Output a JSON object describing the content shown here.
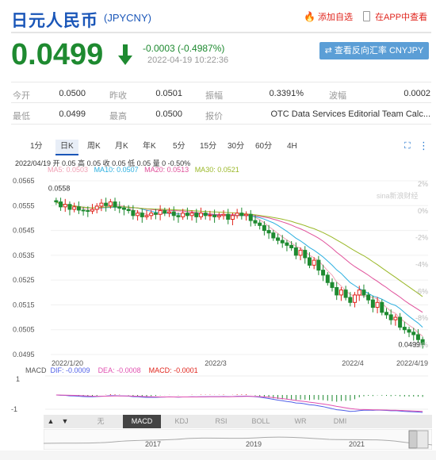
{
  "header": {
    "title": "日元人民币",
    "code": "(JPYCNY)",
    "add_watchlist": "添加自选",
    "app_view": "在APP中查看"
  },
  "quote": {
    "price": "0.0499",
    "change": "-0.0003 (-0.4987%)",
    "timestamp": "2022-04-19 10:22:36",
    "reverse_button": "查看反向汇率 CNYJPY",
    "direction": "down"
  },
  "stats": {
    "row1": [
      {
        "label": "今开",
        "value": "0.0500"
      },
      {
        "label": "昨收",
        "value": "0.0501"
      },
      {
        "label": "振幅",
        "value": "0.3391%"
      },
      {
        "label": "波幅",
        "value": "0.0002"
      }
    ],
    "row2": [
      {
        "label": "最低",
        "value": "0.0499"
      },
      {
        "label": "最高",
        "value": "0.0500"
      },
      {
        "label": "报价",
        "value": "OTC Data Services Editorial Team Calc..."
      }
    ]
  },
  "tabs": [
    "1分",
    "日K",
    "周K",
    "月K",
    "年K",
    "5分",
    "15分",
    "30分",
    "60分",
    "4H"
  ],
  "active_tab": "日K",
  "chart_info": {
    "line1": "2022/04/19 开 0.05 高 0.05 收 0.05 低 0.05 量 0 -0.50%",
    "ma5": "MA5: 0.0503",
    "ma10": "MA10: 0.0507",
    "ma20": "MA20: 0.0513",
    "ma30": "MA30: 0.0521"
  },
  "chart_data": {
    "type": "candlestick",
    "price_ticks": [
      "0.0565",
      "0.0555",
      "0.0545",
      "0.0535",
      "0.0525",
      "0.0515",
      "0.0505",
      "0.0495"
    ],
    "pct_ticks": [
      "2%",
      "0%",
      "-2%",
      "-4%",
      "-6%",
      "-8%",
      "-10%"
    ],
    "ylim": [
      0.0495,
      0.0565
    ],
    "x_labels": [
      "2022/1/20",
      "2022/3",
      "2022/4",
      "2022/4/19"
    ],
    "annotations": {
      "high": "0.0558",
      "last": "0.0499"
    },
    "watermark": "sina新浪财经",
    "series_colors": {
      "up": "#e0241c",
      "down": "#1e8a30",
      "ma5": "#f0a0b4",
      "ma10": "#2cb0e0",
      "ma20": "#e0509a",
      "ma30": "#9ab828"
    },
    "closes": [
      0.05565,
      0.05545,
      0.05555,
      0.05535,
      0.05545,
      0.05532,
      0.0553,
      0.05528,
      0.05535,
      0.05548,
      0.0556,
      0.0555,
      0.05565,
      0.05545,
      0.0554,
      0.05535,
      0.0553,
      0.0551,
      0.0552,
      0.05505,
      0.0551,
      0.0552,
      0.05515,
      0.0553,
      0.0552,
      0.05525,
      0.0551,
      0.05505,
      0.0552,
      0.0551,
      0.0552,
      0.05505,
      0.0552,
      0.0551,
      0.05512,
      0.05505,
      0.0551,
      0.05515,
      0.05495,
      0.0551,
      0.0552,
      0.0551,
      0.05515,
      0.0549,
      0.0548,
      0.0547,
      0.0545,
      0.0544,
      0.0542,
      0.0541,
      0.054,
      0.0539,
      0.0538,
      0.0535,
      0.0537,
      0.0534,
      0.0531,
      0.0533,
      0.0529,
      0.0527,
      0.0524,
      0.0522,
      0.0519,
      0.0521,
      0.0518,
      0.0516,
      0.0519,
      0.0521,
      0.0519,
      0.0517,
      0.0514,
      0.0516,
      0.0512,
      0.0511,
      0.0509,
      0.051,
      0.0506,
      0.0505,
      0.0504,
      0.0503,
      0.0501,
      0.0499
    ]
  },
  "macd": {
    "label": "MACD",
    "dif": "DIF: -0.0009",
    "dea": "DEA: -0.0008",
    "macd": "MACD: -0.0001",
    "ticks": [
      "1",
      "-1"
    ]
  },
  "indicator_tabs": [
    "无",
    "MACD",
    "KDJ",
    "RSI",
    "BOLL",
    "WR",
    "DMI"
  ],
  "active_indicator": "MACD",
  "navigator_years": [
    "2017",
    "2019",
    "2021"
  ]
}
